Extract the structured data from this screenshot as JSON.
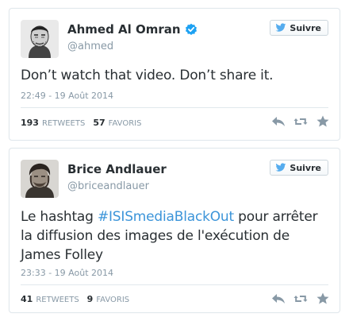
{
  "tweets": [
    {
      "name": "Ahmed Al Omran",
      "handle": "@ahmed",
      "verified": true,
      "follow_label": "Suivre",
      "text_parts": [
        "Don’t watch that video. Don’t share it."
      ],
      "date": "22:49 - 19 Août 2014",
      "retweets_count": "193",
      "retweets_label": "RETWEETS",
      "favorites_count": "57",
      "favorites_label": "FAVORIS"
    },
    {
      "name": "Brice Andlauer",
      "handle": "@briceandlauer",
      "verified": false,
      "follow_label": "Suivre",
      "text_before": "Le hashtag ",
      "hashtag": "#ISISmediaBlackOut",
      "text_after": " pour arrêter la diffusion des images de l'exécution de James Folley",
      "date": "23:33 - 19 Août 2014",
      "retweets_count": "41",
      "retweets_label": "RETWEETS",
      "favorites_count": "9",
      "favorites_label": "FAVORIS"
    }
  ],
  "colors": {
    "link": "#3b94d9",
    "muted": "#8899a6",
    "text": "#292f33",
    "twitter_bird": "#55acee",
    "verified": "#1da1f2"
  },
  "icons": [
    "twitter-bird-icon",
    "verified-icon",
    "reply-icon",
    "retweet-icon",
    "favorite-star-icon"
  ]
}
